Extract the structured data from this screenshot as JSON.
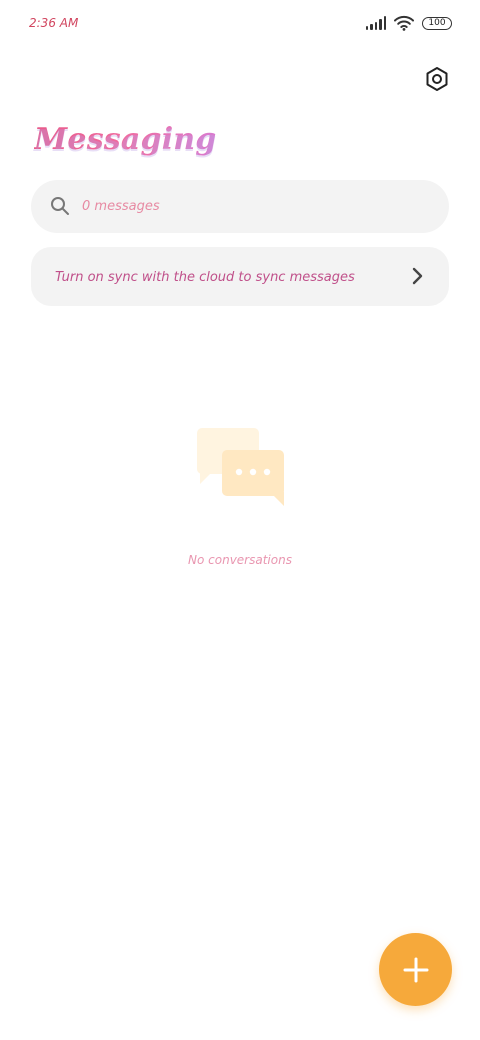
{
  "status_bar": {
    "time": "2:36 AM",
    "battery": "100",
    "icons": [
      "signal-icon",
      "wifi-icon",
      "battery-icon"
    ]
  },
  "header": {
    "title": "Messaging",
    "settings_icon": "settings-hex-icon"
  },
  "search": {
    "placeholder": "0 messages",
    "icon": "search-icon"
  },
  "sync_banner": {
    "text": "Turn on sync with the cloud to sync messages",
    "icon": "chevron-right-icon"
  },
  "empty_state": {
    "text": "No conversations",
    "icon": "chat-bubbles-icon"
  },
  "fab": {
    "icon": "plus-icon",
    "color": "#f6a93b"
  },
  "colors": {
    "accent_pink": "#e85a8a",
    "text_pink": "#c0508a",
    "fab_orange": "#f6a93b",
    "card_bg": "#f3f3f3"
  }
}
